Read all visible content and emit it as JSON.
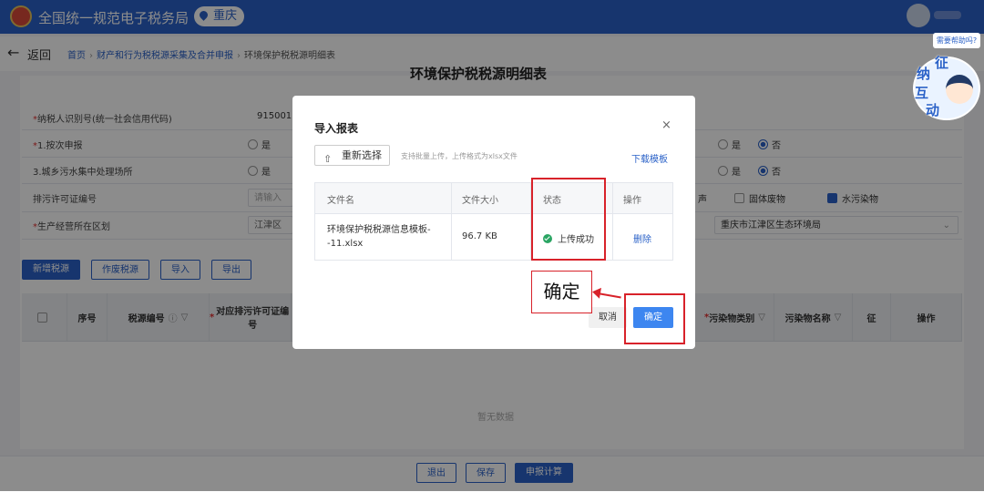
{
  "header": {
    "app_title": "全国统一规范电子税务局",
    "region": "重庆"
  },
  "breadcrumb": {
    "back": "返回",
    "items": [
      "首页",
      "财产和行为税税源采集及合并申报",
      "环境保护税税源明细表"
    ]
  },
  "form": {
    "title": "环境保护税税源明细表",
    "rows": [
      {
        "label": "纳税人识别号(统一社会信用代码)",
        "required": true,
        "value": "915001"
      },
      {
        "label": "1.按次申报",
        "required": true,
        "opt_yes": "是",
        "right_yes": "是",
        "right_no": "否"
      },
      {
        "label": "3.城乡污水集中处理场所",
        "required": false,
        "opt_yes": "是",
        "right_yes": "是",
        "right_no": "否"
      },
      {
        "label": "排污许可证编号",
        "required": false,
        "placeholder": "请输入",
        "cb_noise": "声",
        "cb_solid": "固体废物",
        "cb_water": "水污染物"
      },
      {
        "label": "生产经营所在区划",
        "required": true,
        "district": "江津区",
        "authority": "重庆市江津区生态环境局"
      }
    ],
    "actions": [
      "新增税源",
      "作废税源",
      "导入",
      "导出"
    ]
  },
  "table": {
    "headers": [
      "序号",
      "税源编号",
      "对应排污许可证编号",
      "污染物类别",
      "污染物名称",
      "征",
      "操作"
    ],
    "empty_text": "暂无数据"
  },
  "footer_buttons": [
    "退出",
    "保存",
    "申报计算"
  ],
  "helper": {
    "bubble": "需要帮助吗?",
    "chars": [
      "征",
      "纳",
      "互",
      "动"
    ]
  },
  "dialog": {
    "title": "导入报表",
    "close": "×",
    "reselect": "重新选择",
    "upload_icon": "upload-icon",
    "hint": "支持批量上传，上传格式为xlsx文件",
    "download_template": "下载模板",
    "columns": [
      "文件名",
      "文件大小",
      "状态",
      "操作"
    ],
    "file": {
      "name": "环境保护税税源信息模板--11.xlsx",
      "size": "96.7 KB",
      "status": "上传成功",
      "action": "删除"
    },
    "cancel": "取消",
    "confirm": "确定"
  },
  "annotation": {
    "callout": "确定",
    "color": "#d8222a"
  },
  "colors": {
    "primary": "#2b62c8",
    "success": "#2aa563",
    "required": "#e03030"
  }
}
